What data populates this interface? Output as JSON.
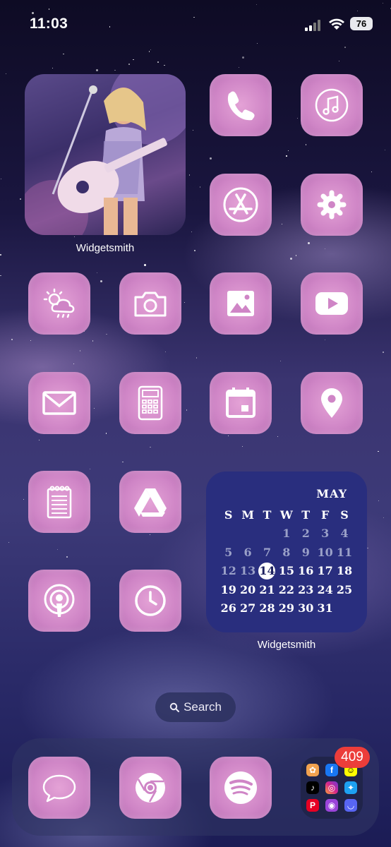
{
  "status_bar": {
    "time": "11:03",
    "battery": "76",
    "icons": [
      "signal-icon",
      "wifi-icon",
      "battery-icon"
    ]
  },
  "widgets": {
    "photo": {
      "label": "Widgetsmith"
    },
    "calendar": {
      "label": "Widgetsmith",
      "month": "MAY",
      "weekdays": [
        "S",
        "M",
        "T",
        "W",
        "T",
        "F",
        "S"
      ],
      "weeks": [
        [
          "",
          "",
          "",
          "1",
          "2",
          "3",
          "4"
        ],
        [
          "5",
          "6",
          "7",
          "8",
          "9",
          "10",
          "11"
        ],
        [
          "12",
          "13",
          "14",
          "15",
          "16",
          "17",
          "18"
        ],
        [
          "19",
          "20",
          "21",
          "22",
          "23",
          "24",
          "25"
        ],
        [
          "26",
          "27",
          "28",
          "29",
          "30",
          "31",
          ""
        ]
      ],
      "today": "14"
    }
  },
  "apps": [
    {
      "icon": "phone-icon"
    },
    {
      "icon": "music-icon"
    },
    {
      "icon": "app-store-icon"
    },
    {
      "icon": "settings-gear-icon"
    },
    {
      "icon": "weather-icon"
    },
    {
      "icon": "camera-icon"
    },
    {
      "icon": "photos-icon"
    },
    {
      "icon": "youtube-icon"
    },
    {
      "icon": "mail-icon"
    },
    {
      "icon": "calculator-icon"
    },
    {
      "icon": "calendar-icon"
    },
    {
      "icon": "maps-pin-icon"
    },
    {
      "icon": "notes-icon"
    },
    {
      "icon": "google-drive-icon"
    },
    {
      "icon": "podcasts-icon"
    },
    {
      "icon": "clock-icon"
    }
  ],
  "search": {
    "label": "Search"
  },
  "dock": {
    "apps": [
      {
        "icon": "messages-icon"
      },
      {
        "icon": "chrome-icon"
      },
      {
        "icon": "spotify-icon"
      }
    ],
    "folder": {
      "badge": "409",
      "apps": [
        "photos",
        "facebook",
        "snapchat",
        "tiktok",
        "instagram",
        "twitter",
        "pinterest",
        "podcasts",
        "discord"
      ]
    }
  }
}
